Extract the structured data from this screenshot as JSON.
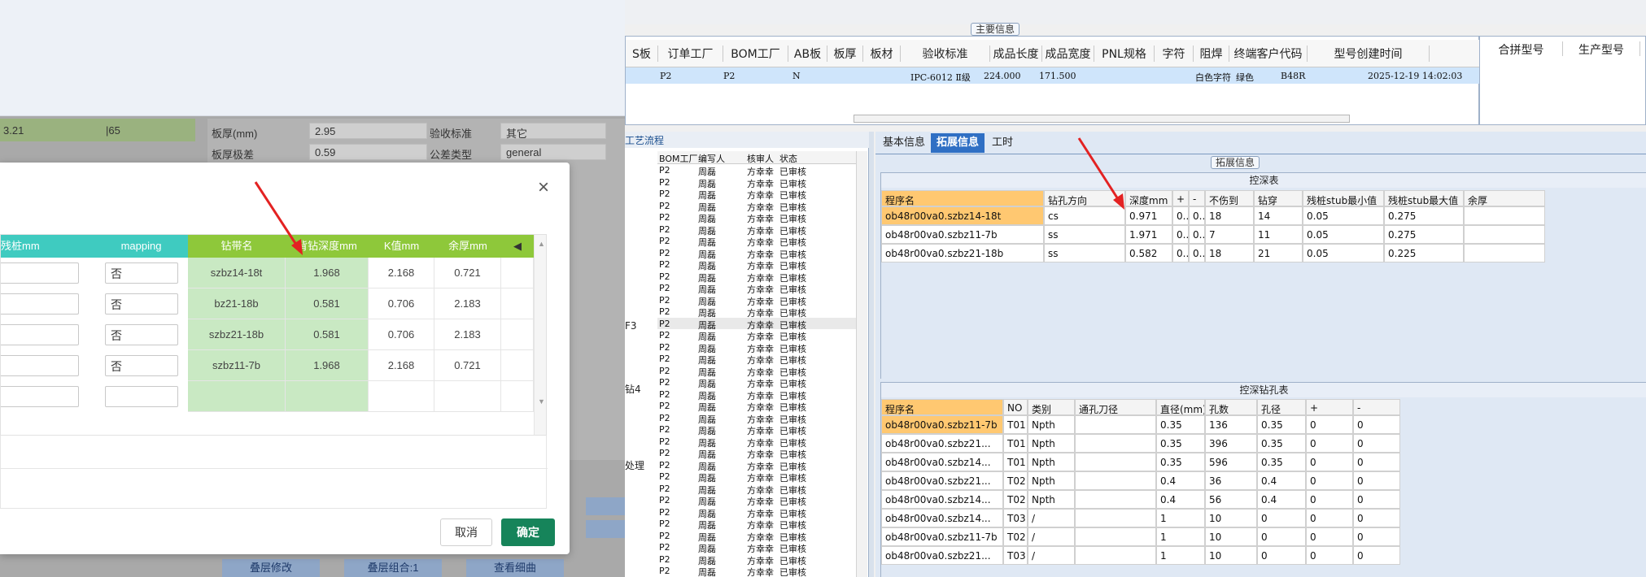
{
  "left": {
    "row1": {
      "v1": "3.21",
      "v2": "|65"
    },
    "form_rows": [
      {
        "label": "板厚(mm)",
        "value": "2.95",
        "label2": "验收标准",
        "value2": "其它"
      },
      {
        "label": "板厚极差",
        "value": "0.59",
        "label2": "公差类型",
        "value2": "general"
      }
    ],
    "bottom_buttons": [
      "叠层修改",
      "叠层组合:1",
      "查看细曲"
    ]
  },
  "modal": {
    "close_glyph": "×",
    "headers": [
      "残桩mm",
      "mapping",
      "钻带名",
      "背钻深度mm",
      "K值mm",
      "余厚mm"
    ],
    "scroll_glyph": "◀",
    "rows": [
      {
        "mapping": "否",
        "drill": "szbz14-18t",
        "depth": "1.968",
        "k": "2.168",
        "rest": "0.721"
      },
      {
        "mapping": "否",
        "drill": "bz21-18b",
        "depth": "0.581",
        "k": "0.706",
        "rest": "2.183"
      },
      {
        "mapping": "否",
        "drill": "szbz21-18b",
        "depth": "0.581",
        "k": "0.706",
        "rest": "2.183"
      },
      {
        "mapping": "否",
        "drill": "szbz11-7b",
        "depth": "1.968",
        "k": "2.168",
        "rest": "0.721"
      }
    ],
    "cancel": "取消",
    "ok": "确定"
  },
  "right": {
    "main_info_title": "主要信息",
    "main_headers": [
      "S板",
      "订单工厂",
      "BOM工厂",
      "AB板",
      "板厚",
      "板材",
      "验收标准",
      "成品长度",
      "成品宽度",
      "PNL规格",
      "字符",
      "阻焊",
      "终端客户代码",
      "型号创建时间"
    ],
    "main_row": [
      "P2",
      "P2",
      "N",
      "IPC-6012 Ⅱ级",
      "224.000",
      "171.500",
      "白色字符",
      "绿色",
      "B48R",
      "2025-12-19 14:02:03"
    ],
    "side_headers": [
      "合拼型号",
      "生产型号"
    ],
    "flow_title": "工艺流程",
    "flow_headers": [
      "BOM工厂",
      "编写人",
      "核审人",
      "状态"
    ],
    "flow_rows": [
      {
        "a": "P2",
        "b": "周磊",
        "c": "方幸幸",
        "d": "已审核"
      },
      {
        "a": "P2",
        "b": "周磊",
        "c": "方幸幸",
        "d": "已审核"
      },
      {
        "a": "P2",
        "b": "周磊",
        "c": "方幸幸",
        "d": "已审核"
      },
      {
        "a": "P2",
        "b": "周磊",
        "c": "方幸幸",
        "d": "已审核"
      },
      {
        "a": "P2",
        "b": "周磊",
        "c": "方幸幸",
        "d": "已审核"
      },
      {
        "a": "P2",
        "b": "周磊",
        "c": "方幸幸",
        "d": "已审核"
      },
      {
        "a": "P2",
        "b": "周磊",
        "c": "方幸幸",
        "d": "已审核"
      },
      {
        "a": "P2",
        "b": "周磊",
        "c": "方幸幸",
        "d": "已审核"
      },
      {
        "a": "P2",
        "b": "周磊",
        "c": "方幸幸",
        "d": "已审核"
      },
      {
        "a": "P2",
        "b": "周磊",
        "c": "方幸幸",
        "d": "已审核"
      },
      {
        "a": "P2",
        "b": "周磊",
        "c": "方幸幸",
        "d": "已审核"
      },
      {
        "a": "P2",
        "b": "周磊",
        "c": "方幸幸",
        "d": "已审核"
      },
      {
        "a": "P2",
        "b": "周磊",
        "c": "方幸幸",
        "d": "已审核"
      },
      {
        "a": "P2",
        "b": "周磊",
        "c": "方幸幸",
        "d": "已审核"
      },
      {
        "a": "P2",
        "b": "周磊",
        "c": "方幸幸",
        "d": "已审核"
      },
      {
        "a": "P2",
        "b": "周磊",
        "c": "方幸幸",
        "d": "已审核"
      },
      {
        "a": "P2",
        "b": "周磊",
        "c": "方幸幸",
        "d": "已审核"
      },
      {
        "a": "P2",
        "b": "周磊",
        "c": "方幸幸",
        "d": "已审核"
      },
      {
        "a": "P2",
        "b": "周磊",
        "c": "方幸幸",
        "d": "已审核"
      },
      {
        "a": "P2",
        "b": "周磊",
        "c": "方幸幸",
        "d": "已审核"
      },
      {
        "a": "P2",
        "b": "周磊",
        "c": "方幸幸",
        "d": "已审核"
      },
      {
        "a": "P2",
        "b": "周磊",
        "c": "方幸幸",
        "d": "已审核"
      },
      {
        "a": "P2",
        "b": "周磊",
        "c": "方幸幸",
        "d": "已审核"
      },
      {
        "a": "P2",
        "b": "周磊",
        "c": "方幸幸",
        "d": "已审核"
      },
      {
        "a": "P2",
        "b": "周磊",
        "c": "方幸幸",
        "d": "已审核"
      },
      {
        "a": "P2",
        "b": "周磊",
        "c": "方幸幸",
        "d": "已审核"
      },
      {
        "a": "P2",
        "b": "周磊",
        "c": "方幸幸",
        "d": "已审核"
      },
      {
        "a": "P2",
        "b": "周磊",
        "c": "方幸幸",
        "d": "已审核"
      },
      {
        "a": "P2",
        "b": "周磊",
        "c": "方幸幸",
        "d": "已审核"
      },
      {
        "a": "P2",
        "b": "周磊",
        "c": "方幸幸",
        "d": "已审核"
      },
      {
        "a": "P2",
        "b": "周磊",
        "c": "方幸幸",
        "d": "已审核"
      },
      {
        "a": "P2",
        "b": "周磊",
        "c": "方幸幸",
        "d": "已审核"
      },
      {
        "a": "P2",
        "b": "周磊",
        "c": "方幸幸",
        "d": "已审核"
      },
      {
        "a": "P2",
        "b": "周磊",
        "c": "方幸幸",
        "d": "已审核"
      },
      {
        "a": "P2",
        "b": "周磊",
        "c": "方幸幸",
        "d": "已审核"
      }
    ],
    "flow_side_labels": [
      "F3",
      "钻4",
      "处理"
    ],
    "tabs": [
      "基本信息",
      "拓展信息",
      "工时"
    ],
    "ext_title": "拓展信息",
    "ctrl_depth_title": "控深表",
    "depth_headers": [
      "程序名",
      "钻孔方向",
      "深度mm",
      "+",
      "-",
      "不伤到",
      "钻穿",
      "残桩stub最小值",
      "残桩stub最大值",
      "余厚"
    ],
    "depth_rows": [
      [
        "ob48r00va0.szbz14-18t",
        "cs",
        "0.971",
        "0..",
        "0..",
        "18",
        "14",
        "0.05",
        "0.275",
        ""
      ],
      [
        "ob48r00va0.szbz11-7b",
        "ss",
        "1.971",
        "0..",
        "0..",
        "7",
        "11",
        "0.05",
        "0.275",
        ""
      ],
      [
        "ob48r00va0.szbz21-18b",
        "ss",
        "0.582",
        "0..",
        "0..",
        "18",
        "21",
        "0.05",
        "0.225",
        ""
      ]
    ],
    "hole_title": "控深钻孔表",
    "hole_headers": [
      "程序名",
      "NO",
      "类别",
      "通孔刀径",
      "直径(mm)",
      "孔数",
      "孔径",
      "+",
      "-"
    ],
    "hole_rows": [
      [
        "ob48r00va0.szbz11-7b",
        "T01",
        "Npth",
        "",
        "0.35",
        "136",
        "0.35",
        "0",
        "0"
      ],
      [
        "ob48r00va0.szbz21...",
        "T01",
        "Npth",
        "",
        "0.35",
        "396",
        "0.35",
        "0",
        "0"
      ],
      [
        "ob48r00va0.szbz14...",
        "T01",
        "Npth",
        "",
        "0.35",
        "596",
        "0.35",
        "0",
        "0"
      ],
      [
        "ob48r00va0.szbz21...",
        "T02",
        "Npth",
        "",
        "0.4",
        "36",
        "0.4",
        "0",
        "0"
      ],
      [
        "ob48r00va0.szbz14...",
        "T02",
        "Npth",
        "",
        "0.4",
        "56",
        "0.4",
        "0",
        "0"
      ],
      [
        "ob48r00va0.szbz14...",
        "T03",
        "/",
        "",
        "1",
        "10",
        "0",
        "0",
        "0"
      ],
      [
        "ob48r00va0.szbz11-7b",
        "T02",
        "/",
        "",
        "1",
        "10",
        "0",
        "0",
        "0"
      ],
      [
        "ob48r00va0.szbz21...",
        "T03",
        "/",
        "",
        "1",
        "10",
        "0",
        "0",
        "0"
      ]
    ]
  }
}
